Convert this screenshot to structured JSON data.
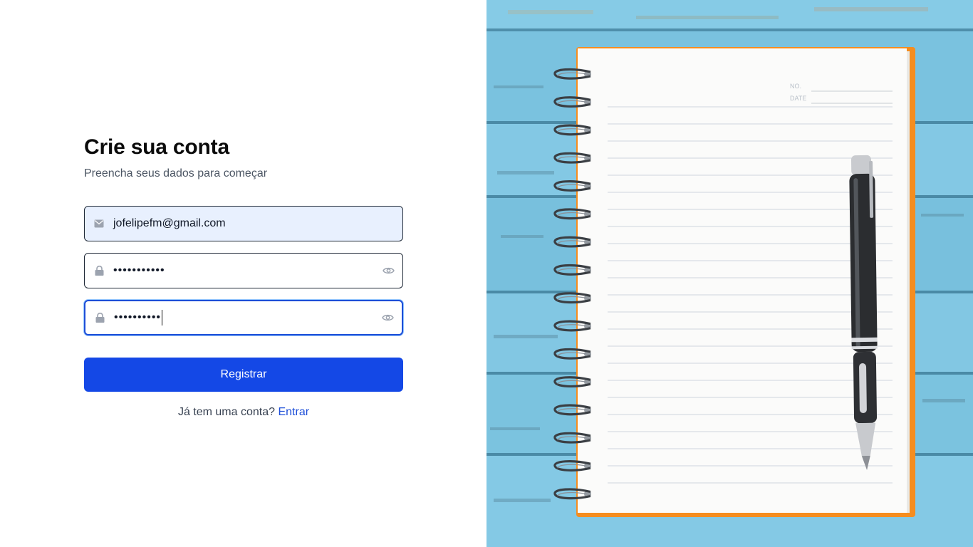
{
  "form": {
    "title": "Crie sua conta",
    "subtitle": "Preencha seus dados para começar",
    "email": {
      "value": "jofelipefm@gmail.com",
      "icon": "mail-icon"
    },
    "password": {
      "value": "•••••••••••",
      "icon": "lock-icon",
      "toggle_icon": "eye-icon"
    },
    "confirm_password": {
      "value": "••••••••••",
      "icon": "lock-icon",
      "toggle_icon": "eye-icon"
    },
    "submit_label": "Registrar",
    "footer_text": "Já tem uma conta?",
    "footer_link": "Entrar"
  },
  "illustration": {
    "notebook_header_labels": [
      "NO.",
      "DATE"
    ]
  },
  "colors": {
    "primary": "#1448e6",
    "link": "#1d4ed8",
    "autofill_bg": "#e8f0fe",
    "wood_blue": "#7cc3e0",
    "notebook_cover": "#f7931e"
  }
}
